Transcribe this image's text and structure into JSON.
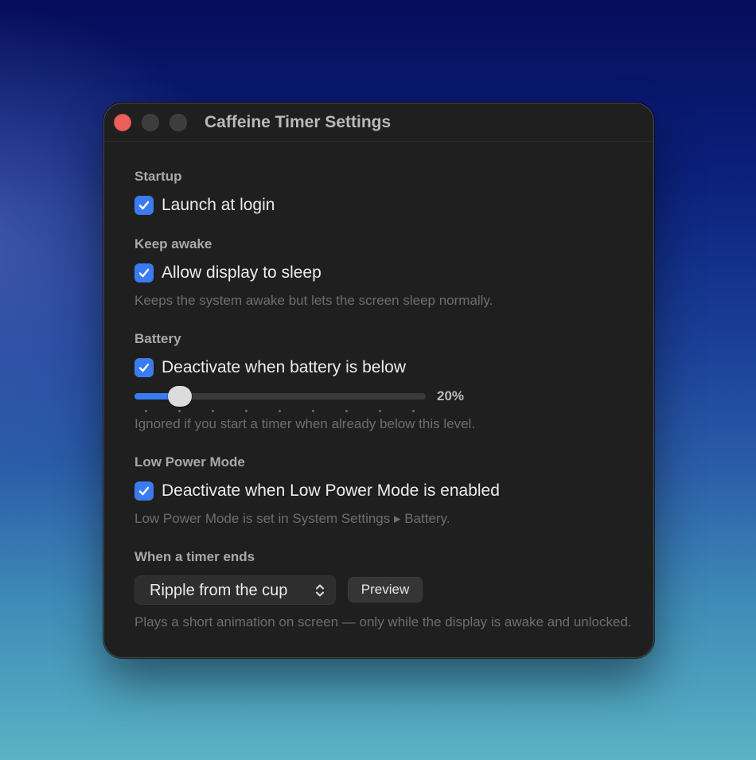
{
  "window": {
    "title": "Caffeine Timer Settings"
  },
  "startup": {
    "heading": "Startup",
    "launch_at_login": {
      "label": "Launch at login",
      "checked": true
    }
  },
  "keep_awake": {
    "heading": "Keep awake",
    "allow_display_sleep": {
      "label": "Allow display to sleep",
      "checked": true
    },
    "help": "Keeps the system awake but lets the screen sleep normally."
  },
  "battery": {
    "heading": "Battery",
    "deactivate_below": {
      "label": "Deactivate when battery is below",
      "checked": true
    },
    "threshold": {
      "value_text": "20%",
      "fraction": 0.12
    },
    "help": "Ignored if you start a timer when already below this level."
  },
  "low_power": {
    "heading": "Low Power Mode",
    "deactivate_lpm": {
      "label": "Deactivate when Low Power Mode is enabled",
      "checked": true
    },
    "help": "Low Power Mode is set in System Settings ▸ Battery."
  },
  "timer_end": {
    "heading": "When a timer ends",
    "animation": {
      "selected": "Ripple from the cup"
    },
    "preview_label": "Preview",
    "help": "Plays a short animation on screen — only while the display is awake and unlocked."
  },
  "colors": {
    "accent": "#3b7bf0",
    "close_button": "#ec5f5a",
    "window_bg": "#1f1f1f"
  },
  "icons": {
    "checkbox": "checkmark-icon",
    "select": "chevron-up-down-icon"
  }
}
